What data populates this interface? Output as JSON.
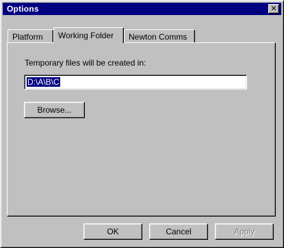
{
  "window": {
    "title": "Options",
    "close_glyph": "✕"
  },
  "tabs": [
    {
      "label": "Platform",
      "active": false
    },
    {
      "label": "Working Folder",
      "active": true
    },
    {
      "label": "Newton Comms",
      "active": false
    }
  ],
  "working_folder": {
    "label": "Temporary files will be created in:",
    "path_value": "D:\\A\\B\\C",
    "browse_label": "Browse..."
  },
  "buttons": {
    "ok_label": "OK",
    "cancel_label": "Cancel",
    "apply_label": "Apply",
    "apply_enabled": false
  },
  "colors": {
    "titlebar": "#000080",
    "face": "#c0c0c0",
    "selection": "#000080"
  }
}
